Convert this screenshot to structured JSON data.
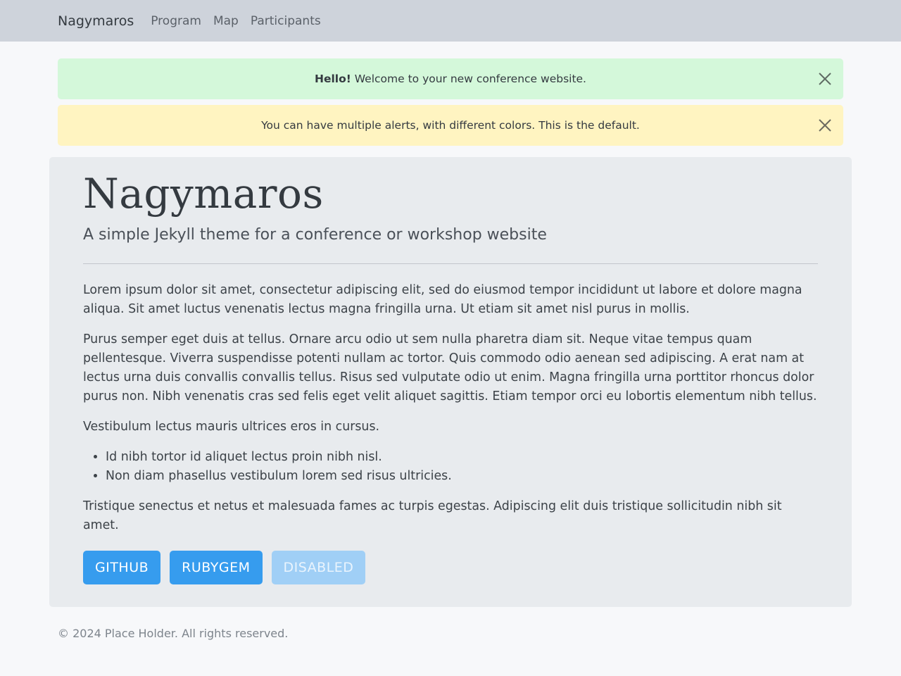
{
  "navbar": {
    "brand": "Nagymaros",
    "links": [
      "Program",
      "Map",
      "Participants"
    ]
  },
  "alerts": [
    {
      "strong": "Hello!",
      "text": " Welcome to your new conference website.",
      "color": "#d4f8da"
    },
    {
      "strong": "",
      "text": "You can have multiple alerts, with different colors. This is the default.",
      "color": "#fff4c1"
    }
  ],
  "jumbotron": {
    "title": "Nagymaros",
    "lead": "A simple Jekyll theme for a conference or workshop website",
    "paragraphs": [
      "Lorem ipsum dolor sit amet, consectetur adipiscing elit, sed do eiusmod tempor incididunt ut labore et dolore magna aliqua. Sit amet luctus venenatis lectus magna fringilla urna. Ut etiam sit amet nisl purus in mollis.",
      "Purus semper eget duis at tellus. Ornare arcu odio ut sem nulla pharetra diam sit. Neque vitae tempus quam pellentesque. Viverra suspendisse potenti nullam ac tortor. Quis commodo odio aenean sed adipiscing. A erat nam at lectus urna duis convallis convallis tellus. Risus sed vulputate odio ut enim. Magna fringilla urna porttitor rhoncus dolor purus non. Nibh venenatis cras sed felis eget velit aliquet sagittis. Etiam tempor orci eu lobortis elementum nibh tellus.",
      "Vestibulum lectus mauris ultrices eros in cursus."
    ],
    "list": [
      "Id nibh tortor id aliquet lectus proin nibh nisl.",
      "Non diam phasellus vestibulum lorem sed risus ultricies."
    ],
    "closing": "Tristique senectus et netus et malesuada fames ac turpis egestas. Adipiscing elit duis tristique sollicitudin nibh sit amet.",
    "buttons": [
      {
        "label": "GITHUB",
        "disabled": false
      },
      {
        "label": "RUBYGEM",
        "disabled": false
      },
      {
        "label": "DISABLED",
        "disabled": true
      }
    ]
  },
  "footer": {
    "text": "© 2024 Place Holder. All rights reserved."
  },
  "colors": {
    "navbar_bg": "#ced3db",
    "button_primary": "#369cee",
    "button_disabled": "#a0cff6"
  },
  "icons": {
    "alert_close": "close-icon"
  }
}
